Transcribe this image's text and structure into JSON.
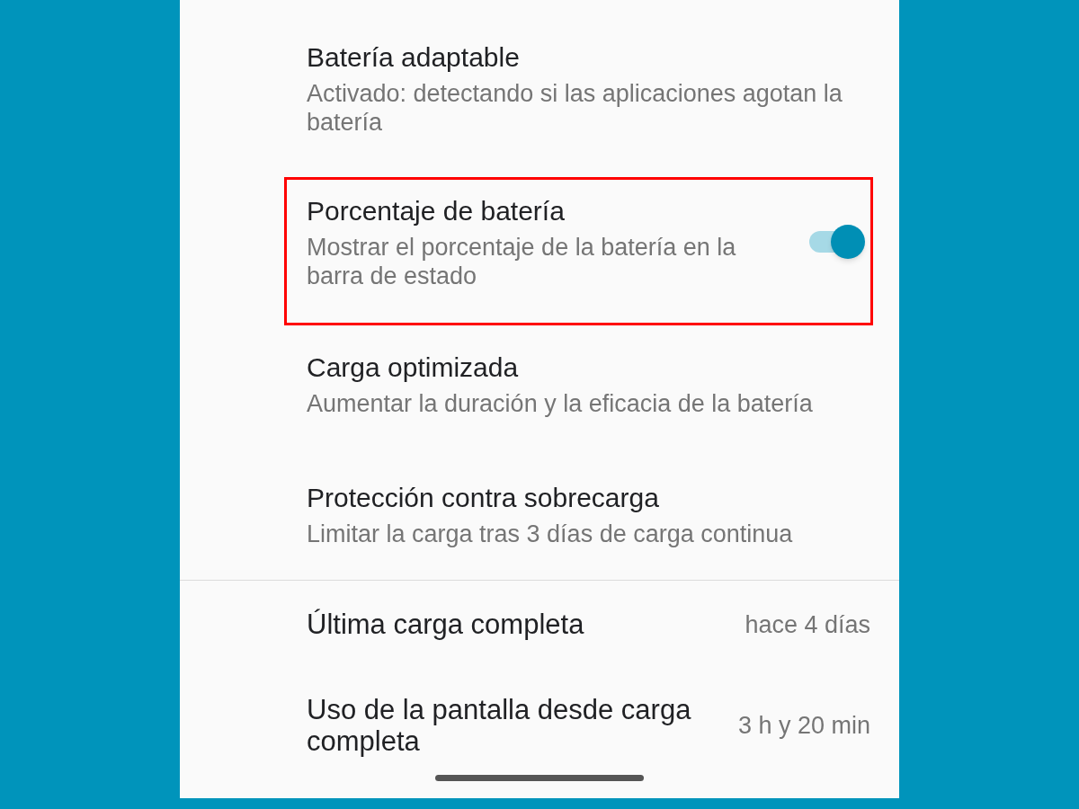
{
  "settings": [
    {
      "kind": "text",
      "title": "Batería adaptable",
      "subtitle": "Activado: detectando si las aplicaciones agotan la batería",
      "highlighted": false
    },
    {
      "kind": "toggle",
      "title": "Porcentaje de batería",
      "subtitle": "Mostrar el porcentaje de la batería en la barra de estado",
      "on": true,
      "highlighted": true
    },
    {
      "kind": "text",
      "title": "Carga optimizada",
      "subtitle": "Aumentar la duración y la eficacia de la batería",
      "highlighted": false
    },
    {
      "kind": "text",
      "title": "Protección contra sobrecarga",
      "subtitle": "Limitar la carga tras 3 días de carga continua",
      "highlighted": false
    }
  ],
  "stats": [
    {
      "label": "Última carga completa",
      "value": "hace 4 días"
    },
    {
      "label": "Uso de la pantalla desde carga completa",
      "value": "3 h y 20 min"
    }
  ]
}
